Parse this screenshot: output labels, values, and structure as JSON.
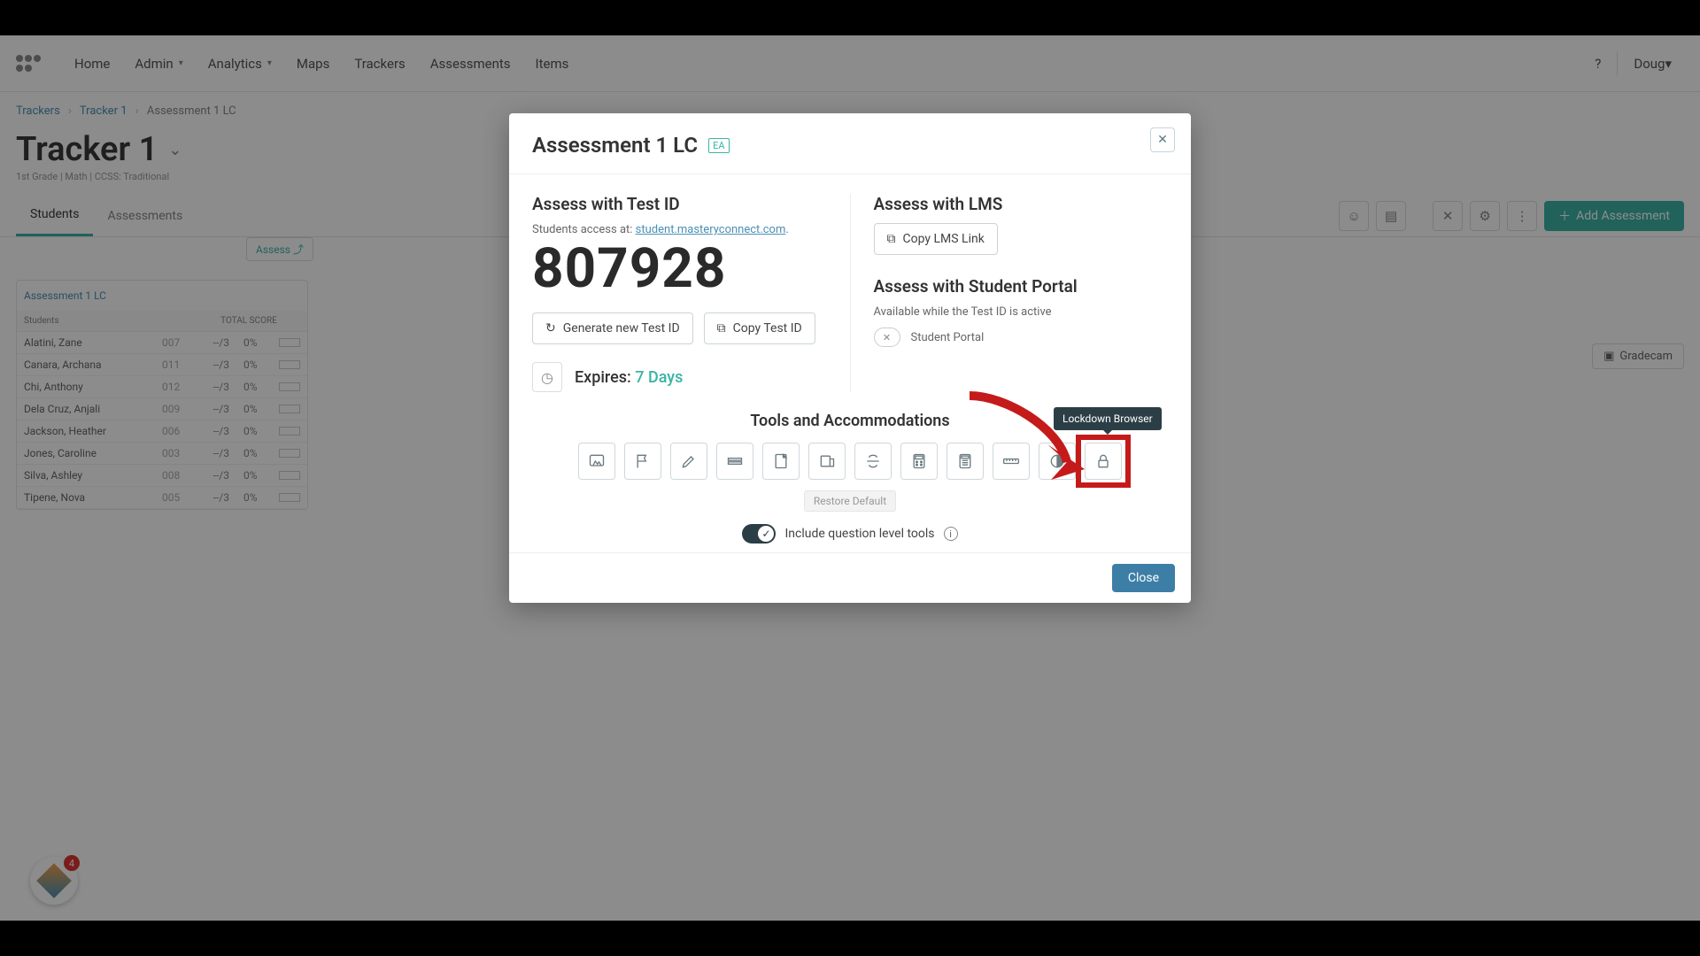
{
  "nav": {
    "items": [
      "Home",
      "Admin",
      "Analytics",
      "Maps",
      "Trackers",
      "Assessments",
      "Items"
    ],
    "dropdown_idx": [
      1,
      2
    ],
    "user": "Doug"
  },
  "breadcrumb": {
    "a": "Trackers",
    "b": "Tracker 1",
    "c": "Assessment 1 LC"
  },
  "page": {
    "title": "Tracker 1",
    "subtitle": "1st Grade  |  Math  |  CCSS: Traditional"
  },
  "tabs": {
    "a": "Students",
    "b": "Assessments"
  },
  "buttons": {
    "add_assessment": "Add Assessment",
    "gradecam": "Gradecam",
    "assess_link": "Assess"
  },
  "table": {
    "title": "Assessment 1 LC",
    "head_students": "Students",
    "head_total": "TOTAL SCORE",
    "rows": [
      {
        "name": "Alatini, Zane",
        "id": "007",
        "score": "--/3",
        "pct": "0%"
      },
      {
        "name": "Canara, Archana",
        "id": "011",
        "score": "--/3",
        "pct": "0%"
      },
      {
        "name": "Chi, Anthony",
        "id": "012",
        "score": "--/3",
        "pct": "0%"
      },
      {
        "name": "Dela Cruz, Anjali",
        "id": "009",
        "score": "--/3",
        "pct": "0%"
      },
      {
        "name": "Jackson, Heather",
        "id": "006",
        "score": "--/3",
        "pct": "0%"
      },
      {
        "name": "Jones, Caroline",
        "id": "003",
        "score": "--/3",
        "pct": "0%"
      },
      {
        "name": "Silva, Ashley",
        "id": "008",
        "score": "--/3",
        "pct": "0%"
      },
      {
        "name": "Tipene, Nova",
        "id": "005",
        "score": "--/3",
        "pct": "0%"
      }
    ]
  },
  "modal": {
    "title": "Assessment 1 LC",
    "left": {
      "heading": "Assess with Test ID",
      "helper_prefix": "Students access at: ",
      "helper_link": "student.masteryconnect.com",
      "test_id": "807928",
      "gen": "Generate new Test ID",
      "copy": "Copy Test ID",
      "expires_label": "Expires: ",
      "expires_value": "7 Days"
    },
    "right": {
      "lms_heading": "Assess with LMS",
      "copy_lms": "Copy LMS Link",
      "portal_heading": "Assess with Student Portal",
      "portal_helper": "Available while the Test ID is active",
      "portal_label": "Student Portal"
    },
    "tools": {
      "heading": "Tools and Accommodations",
      "restore": "Restore Default",
      "include": "Include question level tools",
      "tooltip": "Lockdown Browser",
      "names": [
        "answer-masking",
        "flag",
        "scratchpad",
        "line-reader",
        "notepad",
        "answer-eliminator",
        "strikethrough",
        "basic-calculator",
        "scientific-calculator",
        "ruler",
        "color-contrast",
        "lockdown-browser"
      ]
    },
    "close": "Close"
  },
  "widget_count": "4"
}
